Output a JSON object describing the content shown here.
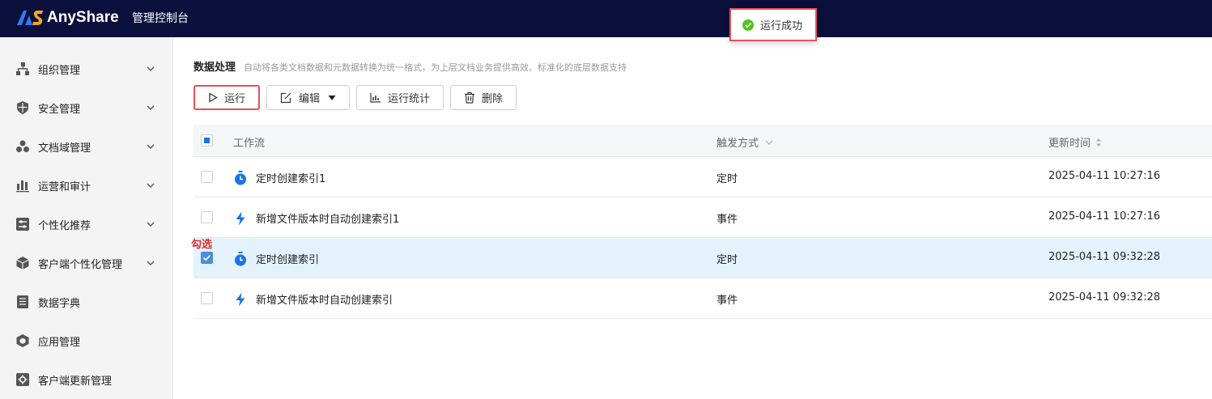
{
  "topbar": {
    "brand": "AnyShare",
    "console_title": "管理控制台"
  },
  "toast": {
    "message": "运行成功",
    "status_color": "#52c41a"
  },
  "sidebar": {
    "items": [
      {
        "label": "组织管理",
        "icon": "org-icon",
        "expandable": true
      },
      {
        "label": "安全管理",
        "icon": "shield-icon",
        "expandable": true
      },
      {
        "label": "文档域管理",
        "icon": "doc-domain-icon",
        "expandable": true
      },
      {
        "label": "运营和审计",
        "icon": "bar-chart-icon",
        "expandable": true
      },
      {
        "label": "个性化推荐",
        "icon": "recommend-icon",
        "expandable": true
      },
      {
        "label": "客户端个性化管理",
        "icon": "cube-icon",
        "expandable": true
      },
      {
        "label": "数据字典",
        "icon": "dictionary-icon",
        "expandable": false
      },
      {
        "label": "应用管理",
        "icon": "app-icon",
        "expandable": false
      },
      {
        "label": "客户端更新管理",
        "icon": "gear-icon",
        "expandable": false
      }
    ]
  },
  "page": {
    "title": "数据处理",
    "description": "自动将各类文档数据和元数据转换为统一格式，为上层文档业务提供高效、标准化的底层数据支持"
  },
  "toolbar": {
    "run": "运行",
    "edit": "编辑",
    "stats": "运行统计",
    "delete": "删除"
  },
  "table": {
    "columns": {
      "workflow": "工作流",
      "trigger": "触发方式",
      "updated": "更新时间"
    },
    "rows": [
      {
        "name": "定时创建索引1",
        "trigger": "定时",
        "updated": "2025-04-11 10:27:16",
        "icon": "timer-icon",
        "checked": false
      },
      {
        "name": "新增文件版本时自动创建索引1",
        "trigger": "事件",
        "updated": "2025-04-11 10:27:16",
        "icon": "lightning-icon",
        "checked": false
      },
      {
        "name": "定时创建索引",
        "trigger": "定时",
        "updated": "2025-04-11 09:32:28",
        "icon": "timer-icon",
        "checked": true
      },
      {
        "name": "新增文件版本时自动创建索引",
        "trigger": "事件",
        "updated": "2025-04-11 09:32:28",
        "icon": "lightning-icon",
        "checked": false
      }
    ]
  },
  "annotation": {
    "text": "勾选",
    "color": "#e32b2b"
  },
  "colors": {
    "topbar": "#0b0f3c",
    "accent": "#1a73e8",
    "highlight_border": "#e35353",
    "selected_row": "#e3f2fb"
  }
}
